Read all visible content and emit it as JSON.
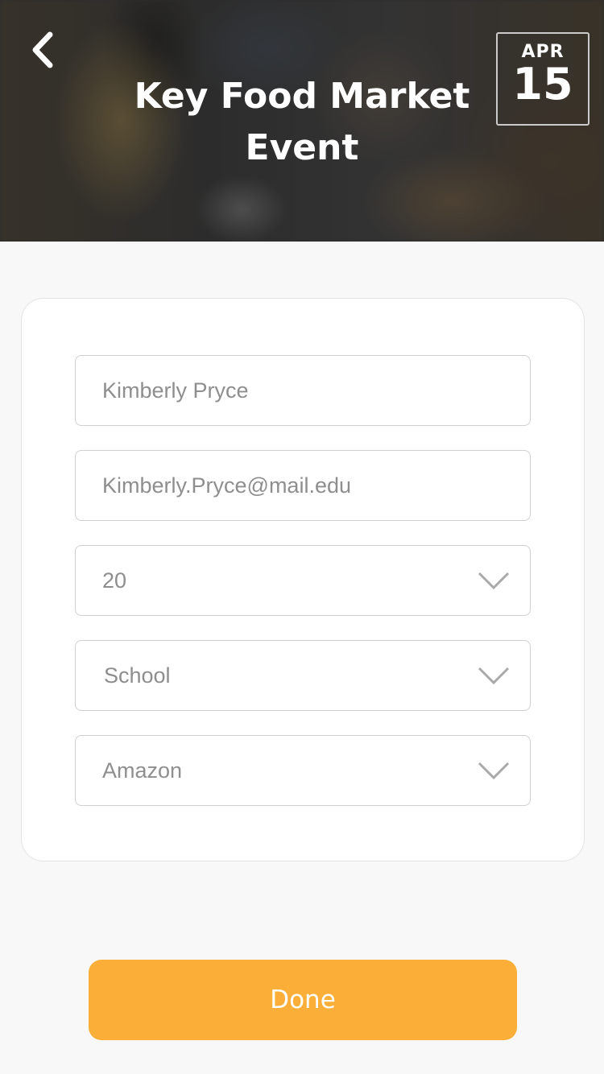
{
  "header": {
    "title": "Key Food Market Event",
    "date": {
      "month": "APR",
      "day": "15"
    },
    "back_icon": "chevron-left-icon"
  },
  "form": {
    "name": {
      "value": "Kimberly Pryce"
    },
    "email": {
      "value": "Kimberly.Pryce@mail.edu"
    },
    "age": {
      "value": "20",
      "icon": "chevron-down-icon"
    },
    "organization": {
      "value": "School",
      "icon": "chevron-down-icon"
    },
    "source": {
      "value": "Amazon",
      "icon": "chevron-down-icon"
    }
  },
  "actions": {
    "done_label": "Done"
  },
  "colors": {
    "accent": "#fbaf39",
    "field_border": "#cfcfcf",
    "field_text": "#8e8e8e",
    "background": "#f8f8f8"
  }
}
